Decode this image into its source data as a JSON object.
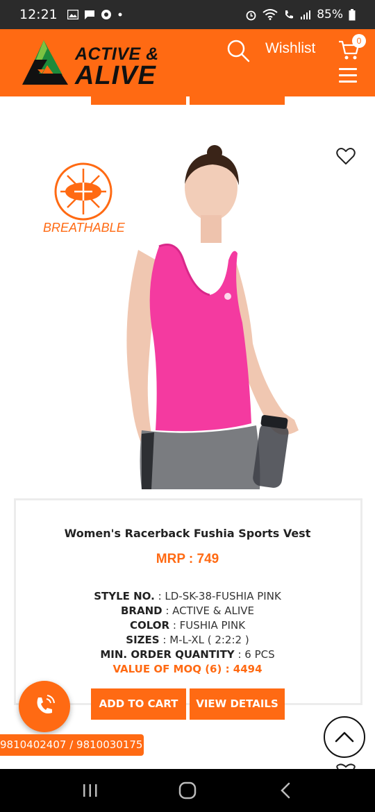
{
  "status_bar": {
    "time": "12:21",
    "battery": "85%",
    "icons_left": [
      "gallery-icon",
      "message-icon",
      "chrome-icon",
      "dot-icon"
    ],
    "icons_right": [
      "alarm-icon",
      "wifi-icon",
      "call-signal-icon",
      "signal-icon",
      "battery-icon"
    ]
  },
  "header": {
    "logo_line1": "ACTIVE &",
    "logo_line2": "ALIVE",
    "wishlist_label": "Wishlist",
    "cart_count": "0",
    "accent_color": "#ff6a13"
  },
  "product": {
    "badge_label": "BREATHABLE",
    "title": "Women's Racerback Fushia Sports Vest",
    "mrp": "MRP : 749",
    "specs": {
      "style_label": "STYLE NO.",
      "style_value": " : LD-SK-38-FUSHIA PINK",
      "brand_label": "BRAND",
      "brand_value": " : ACTIVE & ALIVE",
      "color_label": "COLOR",
      "color_value": " : FUSHIA PINK",
      "sizes_label": "SIZES",
      "sizes_value": " : M-L-XL ( 2:2:2 )",
      "moq_label": "MIN. ORDER QUANTITY",
      "moq_value": "  : 6 PCS"
    },
    "moq_total": "VALUE OF MOQ (6) : 4494",
    "add_to_cart": "ADD TO CART",
    "view_details": "VIEW DETAILS"
  },
  "contact": {
    "phones": "9810402407 / 9810030175"
  }
}
